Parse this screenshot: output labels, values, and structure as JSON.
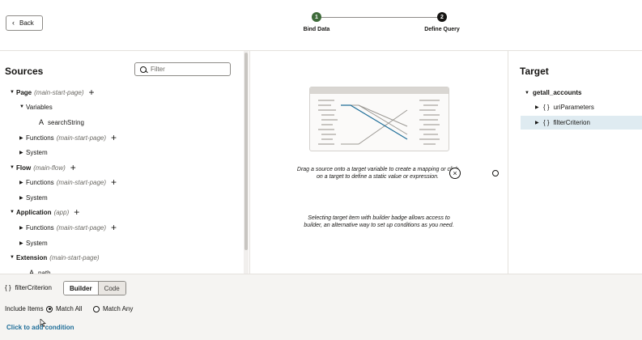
{
  "header": {
    "back_label": "Back",
    "steps": [
      {
        "number": "1",
        "label": "Bind Data",
        "status": "complete"
      },
      {
        "number": "2",
        "label": "Define Query",
        "status": "current"
      }
    ]
  },
  "sources": {
    "title": "Sources",
    "filter_placeholder": "Filter",
    "tree": [
      {
        "name": "Page",
        "context": "(main-start-page)",
        "plus": "+"
      },
      {
        "name": "Variables"
      },
      {
        "name": "searchString",
        "type_glyph": "A"
      },
      {
        "name": "Functions",
        "context": "(main-start-page)",
        "plus": "+"
      },
      {
        "name": "System"
      },
      {
        "name": "Flow",
        "context": "(main-flow)",
        "plus": "+"
      },
      {
        "name": "Functions",
        "context": "(main-start-page)",
        "plus": "+"
      },
      {
        "name": "System"
      },
      {
        "name": "Application",
        "context": "(app)",
        "plus": "+"
      },
      {
        "name": "Functions",
        "context": "(main-start-page)",
        "plus": "+"
      },
      {
        "name": "System"
      },
      {
        "name": "Extension",
        "context": "(main-start-page)"
      },
      {
        "name": "path",
        "type_glyph": "A"
      }
    ]
  },
  "center": {
    "hint_1": "Drag a source onto a target variable to create a mapping or click on a target to define a static value or expression.",
    "hint_2": "Selecting target item with builder badge allows access to builder, an alternative way to set up conditions as you need.",
    "close_glyph": "×"
  },
  "target": {
    "title": "Target",
    "root": "getall_accounts",
    "children": [
      {
        "brace": "{ }",
        "name": "uriParameters"
      },
      {
        "brace": "{ }",
        "name": "filterCriterion",
        "selected": true
      }
    ]
  },
  "bottom": {
    "brace": "{ }",
    "field_name": "filterCriterion",
    "mode_builder": "Builder",
    "mode_code": "Code",
    "include_items_label": "Include Items",
    "match_all": "Match All",
    "match_any": "Match Any",
    "add_condition": "Click to add condition"
  },
  "colors": {
    "step_complete": "#3e6b3a",
    "link": "#1f6e99",
    "selected_row": "#dfebf1"
  }
}
